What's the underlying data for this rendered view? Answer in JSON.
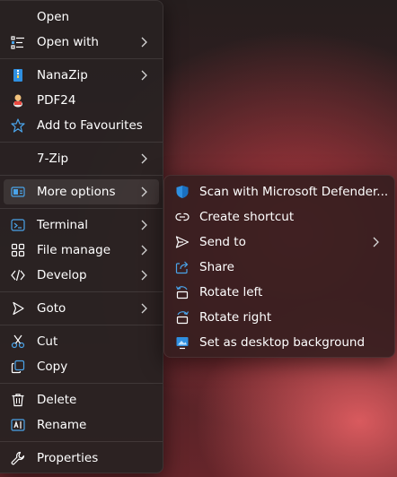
{
  "accent": "#4aa3e8",
  "menu": {
    "items": [
      {
        "label": "Open",
        "icon": "none"
      },
      {
        "label": "Open with",
        "icon": "open-with-icon"
      },
      {
        "label": "NanaZip",
        "icon": "nanazip-icon"
      },
      {
        "label": "PDF24",
        "icon": "pdf24-icon"
      },
      {
        "label": "Add to Favourites",
        "icon": "star-icon"
      },
      {
        "label": "7-Zip",
        "icon": "none"
      },
      {
        "label": "More options",
        "icon": "more-options-icon"
      },
      {
        "label": "Terminal",
        "icon": "terminal-icon"
      },
      {
        "label": "File manage",
        "icon": "file-manage-icon"
      },
      {
        "label": "Develop",
        "icon": "code-icon"
      },
      {
        "label": "Goto",
        "icon": "goto-icon"
      },
      {
        "label": "Cut",
        "icon": "cut-icon"
      },
      {
        "label": "Copy",
        "icon": "copy-icon"
      },
      {
        "label": "Delete",
        "icon": "delete-icon"
      },
      {
        "label": "Rename",
        "icon": "rename-icon"
      },
      {
        "label": "Properties",
        "icon": "wrench-icon"
      }
    ]
  },
  "submenu": {
    "items": [
      {
        "label": "Scan with Microsoft Defender...",
        "icon": "defender-shield-icon"
      },
      {
        "label": "Create shortcut",
        "icon": "link-icon"
      },
      {
        "label": "Send to",
        "icon": "send-icon"
      },
      {
        "label": "Share",
        "icon": "share-icon"
      },
      {
        "label": "Rotate left",
        "icon": "rotate-left-icon"
      },
      {
        "label": "Rotate right",
        "icon": "rotate-right-icon"
      },
      {
        "label": "Set as desktop background",
        "icon": "desktop-background-icon"
      }
    ]
  }
}
